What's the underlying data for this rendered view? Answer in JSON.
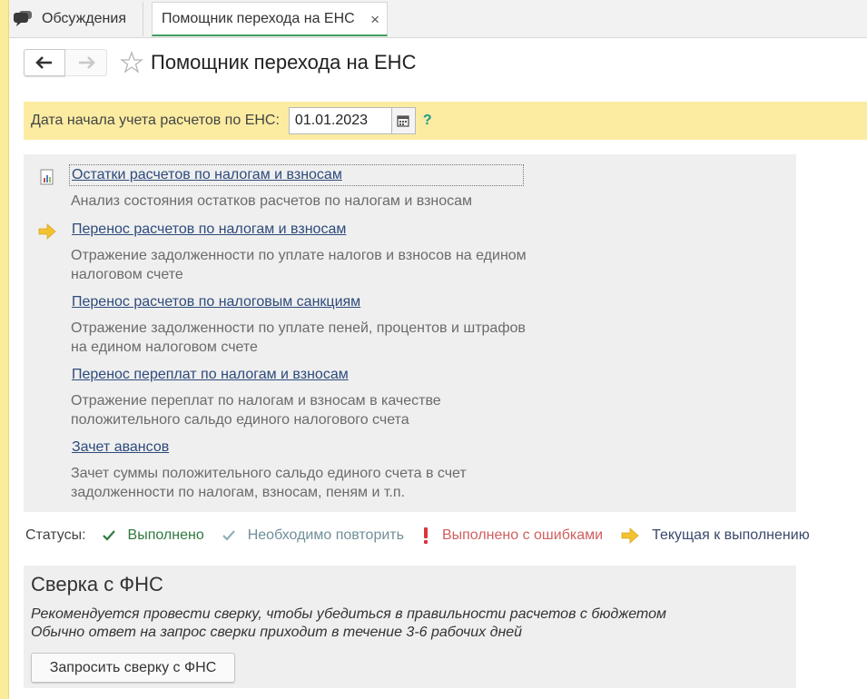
{
  "tabs": [
    {
      "label": "Обсуждения",
      "icon": "chat-bubble-icon",
      "active": false
    },
    {
      "label": "Помощник перехода на ЕНС",
      "active": true,
      "close": "×"
    }
  ],
  "page": {
    "title": "Помощник перехода на ЕНС"
  },
  "date_bar": {
    "label": "Дата начала учета расчетов по ЕНС:",
    "value": "01.01.2023",
    "help": "?"
  },
  "steps": [
    {
      "link": "Остатки расчетов по налогам и взносам",
      "desc": "Анализ состояния остатков расчетов по налогам и взносам",
      "icon": "report-icon"
    },
    {
      "link": "Перенос расчетов по налогам и взносам",
      "desc": "Отражение задолженности по уплате налогов и взносов на едином налоговом счете",
      "icon": "current-arrow-icon"
    },
    {
      "link": "Перенос расчетов по налоговым санкциям",
      "desc": "Отражение задолженности по уплате пеней, процентов и штрафов на едином налоговом счете"
    },
    {
      "link": "Перенос переплат по налогам и взносам",
      "desc": "Отражение переплат по налогам и взносам в качестве положительного сальдо единого налогового счета"
    },
    {
      "link": "Зачет авансов",
      "desc": "Зачет суммы положительного сальдо единого счета в счет задолженности по налогам, взносам, пеням и т.п."
    }
  ],
  "statuses": {
    "label": "Статусы:",
    "items": [
      {
        "label": "Выполнено",
        "icon": "check-icon",
        "color": "#2f7a3f"
      },
      {
        "label": "Необходимо повторить",
        "icon": "check-light-icon",
        "color": "#6f8f9a"
      },
      {
        "label": "Выполнено с ошибками",
        "icon": "exclamation-icon",
        "color": "#d05f5f"
      },
      {
        "label": "Текущая к выполнению",
        "icon": "arrow-icon",
        "color": "#3b4a6b"
      }
    ]
  },
  "fns": {
    "title": "Сверка с ФНС",
    "note1": "Рекомендуется провести сверку, чтобы убедиться в правильности расчетов с бюджетом",
    "note2": "Обычно ответ на запрос сверки приходит в течение 3-6 рабочих дней",
    "button": "Запросить сверку с ФНС"
  },
  "colors": {
    "accent_yellow": "#fbeca2",
    "link_blue": "#2d4b7c",
    "active_tab_underline": "#3f9e5f"
  }
}
